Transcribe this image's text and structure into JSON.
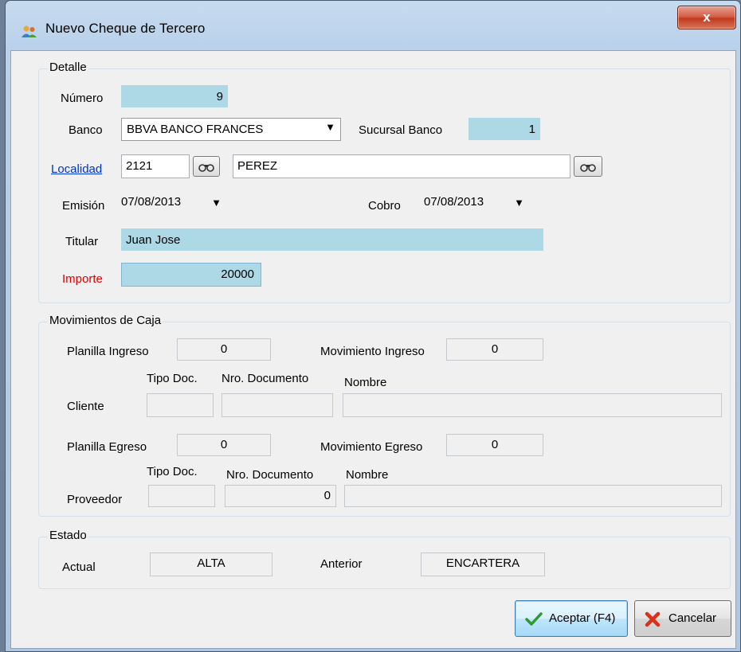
{
  "window": {
    "title": "Nuevo Cheque de Tercero",
    "close_label": "x"
  },
  "detalle": {
    "legend": "Detalle",
    "numero": {
      "label": "Número",
      "value": "9"
    },
    "banco": {
      "label": "Banco",
      "value": "BBVA BANCO FRANCES"
    },
    "sucursal": {
      "label": "Sucursal Banco",
      "value": "1"
    },
    "localidad": {
      "label": "Localidad",
      "code": "2121",
      "name": "PEREZ"
    },
    "emision": {
      "label": "Emisión",
      "value": "07/08/2013"
    },
    "cobro": {
      "label": "Cobro",
      "value": "07/08/2013"
    },
    "titular": {
      "label": "Titular",
      "value": "Juan Jose"
    },
    "importe": {
      "label": "Importe",
      "value": "20000"
    }
  },
  "movimientos": {
    "legend": "Movimientos de Caja",
    "planilla_ingreso": {
      "label": "Planilla Ingreso",
      "value": "0"
    },
    "movimiento_ingreso": {
      "label": "Movimiento Ingreso",
      "value": "0"
    },
    "cliente": {
      "label": "Cliente",
      "tipo_doc_header": "Tipo Doc.",
      "nro_doc_header": "Nro. Documento",
      "nombre_header": "Nombre",
      "tipo_doc": "",
      "nro_doc": "",
      "nombre": ""
    },
    "planilla_egreso": {
      "label": "Planilla Egreso",
      "value": "0"
    },
    "movimiento_egreso": {
      "label": "Movimiento Egreso",
      "value": "0"
    },
    "proveedor": {
      "label": "Proveedor",
      "tipo_doc_header": "Tipo Doc.",
      "nro_doc_header": "Nro. Documento",
      "nombre_header": "Nombre",
      "tipo_doc": "",
      "nro_doc": "0",
      "nombre": ""
    }
  },
  "estado": {
    "legend": "Estado",
    "actual": {
      "label": "Actual",
      "value": "ALTA"
    },
    "anterior": {
      "label": "Anterior",
      "value": "ENCARTERA"
    }
  },
  "buttons": {
    "aceptar": "Aceptar (F4)",
    "cancelar": "Cancelar"
  },
  "colors": {
    "field_highlight": "#add8e6",
    "importe_label": "#e00000",
    "link": "#0033cc"
  }
}
